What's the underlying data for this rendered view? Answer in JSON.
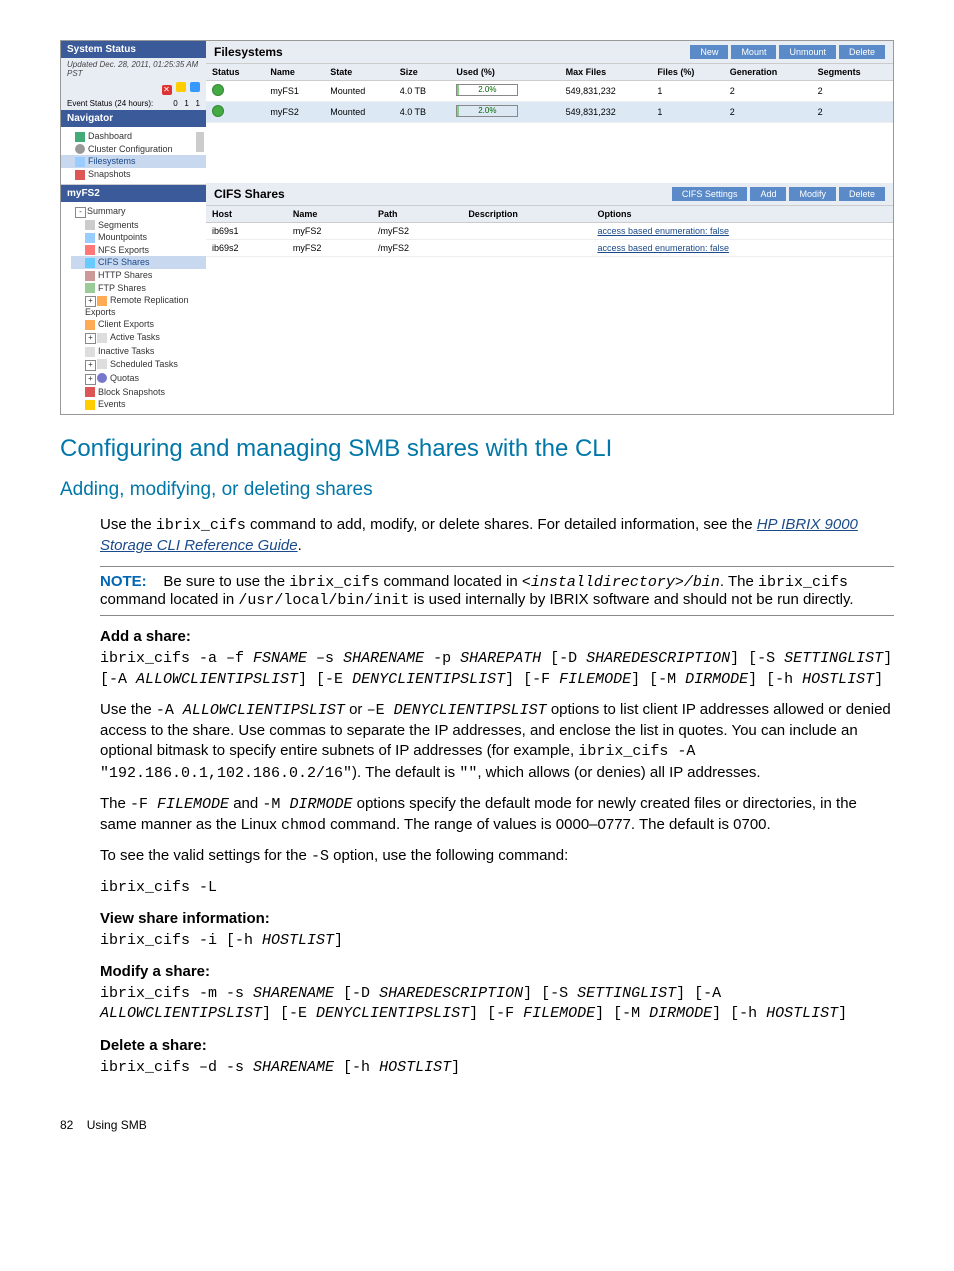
{
  "screenshot": {
    "system_status": {
      "title": "System Status",
      "updated": "Updated Dec. 28, 2011, 01:25:35 AM PST",
      "event_status_label": "Event Status (24 hours):",
      "counts": [
        "0",
        "1",
        "1"
      ]
    },
    "navigator": {
      "title": "Navigator",
      "items": [
        "Dashboard",
        "Cluster Configuration",
        "Filesystems",
        "Snapshots"
      ]
    },
    "myfs2_panel": {
      "title": "myFS2",
      "items": [
        "Summary",
        "Segments",
        "Mountpoints",
        "NFS Exports",
        "CIFS Shares",
        "HTTP Shares",
        "FTP Shares",
        "Remote Replication Exports",
        "Client Exports",
        "Active Tasks",
        "Inactive Tasks",
        "Scheduled Tasks",
        "Quotas",
        "Block Snapshots",
        "Events"
      ]
    },
    "filesystems": {
      "title": "Filesystems",
      "buttons": {
        "new": "New",
        "mount": "Mount",
        "unmount": "Unmount",
        "delete": "Delete"
      },
      "cols": [
        "Status",
        "Name",
        "State",
        "Size",
        "Used (%)",
        "Max Files",
        "Files (%)",
        "Generation",
        "Segments"
      ],
      "rows": [
        {
          "name": "myFS1",
          "state": "Mounted",
          "size": "4.0 TB",
          "used": "2.0%",
          "maxfiles": "549,831,232",
          "files": "1",
          "gen": "2",
          "seg": "2"
        },
        {
          "name": "myFS2",
          "state": "Mounted",
          "size": "4.0 TB",
          "used": "2.0%",
          "maxfiles": "549,831,232",
          "files": "1",
          "gen": "2",
          "seg": "2"
        }
      ]
    },
    "cifs_shares": {
      "title": "CIFS Shares",
      "buttons": {
        "settings": "CIFS Settings",
        "add": "Add",
        "modify": "Modify",
        "delete": "Delete"
      },
      "cols": [
        "Host",
        "Name",
        "Path",
        "Description",
        "Options"
      ],
      "rows": [
        {
          "host": "ib69s1",
          "name": "myFS2",
          "path": "/myFS2",
          "desc": "",
          "opts": "access based enumeration: false"
        },
        {
          "host": "ib69s2",
          "name": "myFS2",
          "path": "/myFS2",
          "desc": "",
          "opts": "access based enumeration: false"
        }
      ]
    }
  },
  "h2": "Configuring and managing SMB shares with the CLI",
  "h3": "Adding, modifying, or deleting shares",
  "p1_a": "Use the ",
  "p1_cmd": "ibrix_cifs",
  "p1_b": " command to add, modify, or delete shares. For detailed information, see the ",
  "p1_link": "HP IBRIX 9000 Storage CLI Reference Guide",
  "p1_c": ".",
  "note": {
    "label": "NOTE:",
    "a": "Be sure to use the ",
    "cmd1": "ibrix_cifs",
    "b": " command located in ",
    "path1": "<installdirectory>/bin",
    "c": ". The ",
    "cmd2": "ibrix_cifs",
    "d": " command located in ",
    "path2": "/usr/local/bin/init",
    "e": " is used internally by IBRIX software and should not be run directly."
  },
  "add": {
    "hdr": "Add a share:",
    "cmd": "ibrix_cifs -a –f FSNAME –s SHARENAME -p SHAREPATH [-D SHAREDESCRIPTION] [-S SETTINGLIST] [-A ALLOWCLIENTIPSLIST] [-E DENYCLIENTIPSLIST] [-F FILEMODE] [-M DIRMODE] [-h HOSTLIST]",
    "p1_a": "Use the ",
    "p1_c1": "-A ",
    "p1_i1": "ALLOWCLIENTIPSLIST",
    "p1_b": " or ",
    "p1_c2": "–E ",
    "p1_i2": "DENYCLIENTIPSLIST",
    "p1_c": " options to list client IP addresses allowed or denied access to the share. Use commas to separate the IP addresses, and enclose the list in quotes. You can include an optional bitmask to specify entire subnets of IP addresses (for example, ",
    "p1_ex": "ibrix_cifs -A \"192.186.0.1,102.186.0.2/16\"",
    "p1_d": "). The default is ",
    "p1_q": "\"\"",
    "p1_e": ", which allows (or denies) all IP addresses.",
    "p2_a": "The ",
    "p2_c1": "-F ",
    "p2_i1": "FILEMODE",
    "p2_b": " and ",
    "p2_c2": "-M ",
    "p2_i2": "DIRMODE",
    "p2_c": " options specify the default mode for newly created files or directories, in the same manner as the Linux ",
    "p2_cmd": "chmod",
    "p2_d": " command. The range of values is 0000–0777. The default is 0700.",
    "p3_a": "To see the valid settings for the ",
    "p3_c": "-S",
    "p3_b": " option, use the following command:",
    "cmd2": "ibrix_cifs -L"
  },
  "view": {
    "hdr": "View share information:",
    "cmd": "ibrix_cifs -i [-h HOSTLIST]"
  },
  "modify": {
    "hdr": "Modify a share:",
    "cmd": "ibrix_cifs -m -s SHARENAME [-D SHAREDESCRIPTION] [-S SETTINGLIST] [-A ALLOWCLIENTIPSLIST] [-E DENYCLIENTIPSLIST] [-F FILEMODE] [-M DIRMODE] [-h HOSTLIST]"
  },
  "delete": {
    "hdr": "Delete a share:",
    "cmd": "ibrix_cifs –d -s SHARENAME [-h HOSTLIST]"
  },
  "footer": {
    "page": "82",
    "label": "Using SMB"
  }
}
